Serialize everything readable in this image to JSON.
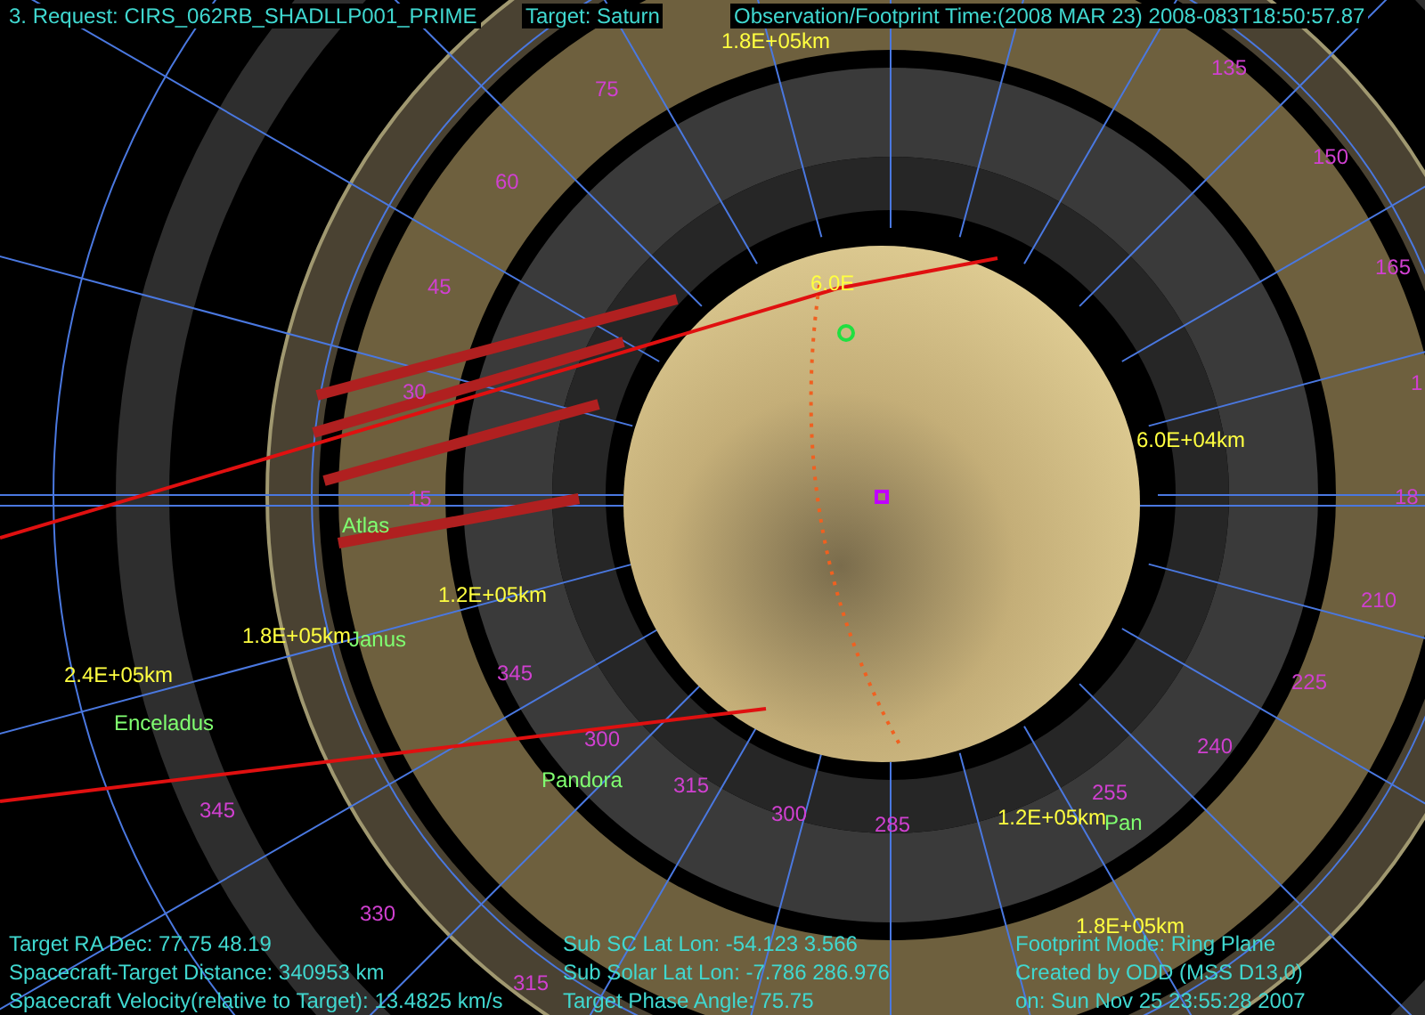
{
  "header": {
    "request": "3. Request: CIRS_062RB_SHADLLP001_PRIME",
    "target": "Target: Saturn",
    "time": "Observation/Footprint Time:(2008 MAR 23) 2008-083T18:50:57.87"
  },
  "longitude_labels": [
    "75",
    "60",
    "45",
    "30",
    "15",
    "135",
    "150",
    "165",
    "1",
    "18",
    "210",
    "225",
    "240",
    "255",
    "285",
    "300",
    "345",
    "300",
    "315",
    "345",
    "330",
    "315"
  ],
  "distance_labels": [
    "1.8E+05km",
    "6.0E",
    "6.0E+04km",
    "1.2E+05km",
    "1.8E+05km",
    "2.4E+05km",
    "1.2E+05km",
    "1.8E+05km"
  ],
  "moons": [
    "Atlas",
    "Janus",
    "Enceladus",
    "Pandora",
    "Pan"
  ],
  "info": {
    "left": [
      "Target RA Dec: 77.75  48.19",
      "Spacecraft-Target Distance:  340953 km",
      "Spacecraft Velocity(relative to Target): 13.4825 km/s"
    ],
    "middle": [
      "Sub SC Lat Lon: -54.123   3.566",
      "Sub Solar Lat Lon: -7.786  286.976",
      "Target Phase Angle: 75.75"
    ],
    "right": [
      "Footprint Mode: Ring Plane",
      "Created by ODD (MSS D13.0)",
      "on: Sun Nov 25 23:55:28 2007"
    ]
  }
}
